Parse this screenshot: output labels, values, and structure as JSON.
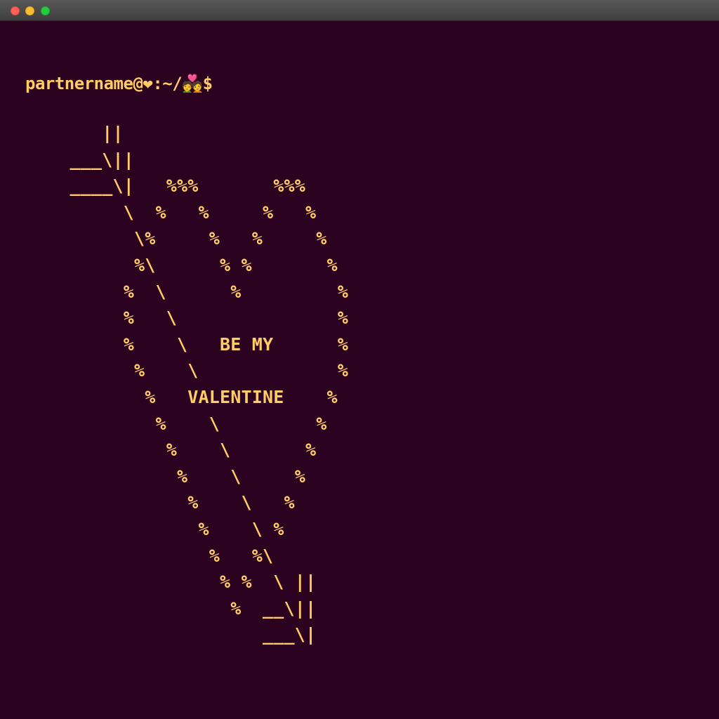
{
  "window": {
    "controls": {
      "close_color": "#ff5f57",
      "minimize_color": "#febc2e",
      "maximize_color": "#28c840"
    }
  },
  "terminal": {
    "background_color": "#2c0221",
    "text_color": "#ffcc66",
    "prompt": "partnername@❤:~/💑$",
    "ascii_art": "     ||\n  ___\\||\n  ____\\|   %%%       %%%\n       \\  %   %     %   %\n        \\%     %   %     %\n        %\\      % %       %\n       %  \\      %         %\n       %   \\               %\n       %    \\   BE MY      %\n        %    \\             %\n         %   VALENTINE    %\n          %    \\         %\n           %    \\       %\n            %    \\     %\n             %    \\   %\n              %    \\ %\n               %   %\\\n                % %  \\ ||\n                 %  __\\||\n                    ___\\|"
  }
}
